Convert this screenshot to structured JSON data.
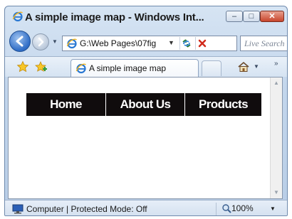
{
  "window": {
    "title": "A simple image map - Windows Int...",
    "controls": {
      "minimize": "–",
      "maximize": "□",
      "close": "✕"
    }
  },
  "navigation": {
    "address": "G:\\Web Pages\\07fig",
    "search_placeholder": "Live Search",
    "icons": [
      "back-arrow-icon",
      "forward-arrow-icon",
      "ie-logo-icon",
      "refresh-icon",
      "stop-icon"
    ]
  },
  "tabs": [
    {
      "label": "A simple image map",
      "active": true
    }
  ],
  "toolbar": {
    "icons": [
      "favorites-star-icon",
      "add-favorites-icon",
      "home-icon"
    ],
    "more": "»"
  },
  "page": {
    "menu": [
      {
        "label": "Home"
      },
      {
        "label": "About Us"
      },
      {
        "label": "Products"
      }
    ],
    "menu_bg": "#100c0d",
    "menu_fg": "#ffffff"
  },
  "status": {
    "text": "Computer | Protected Mode: Off",
    "zoom": "100%"
  }
}
